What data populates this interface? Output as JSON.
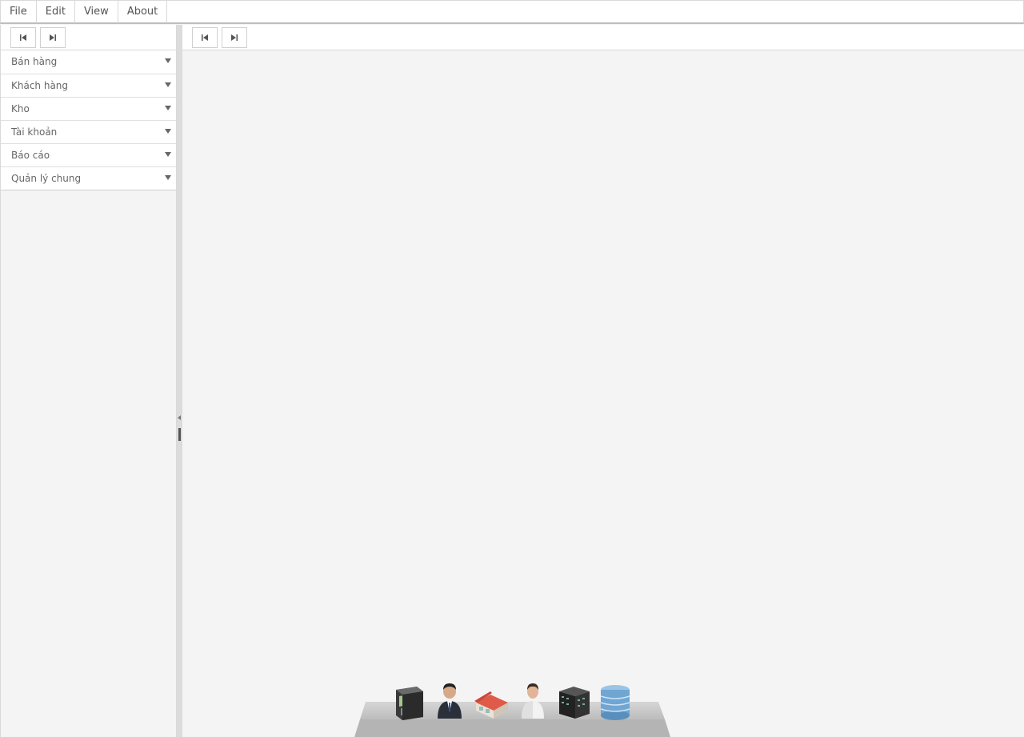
{
  "menubar": {
    "items": [
      {
        "label": "File"
      },
      {
        "label": "Edit"
      },
      {
        "label": "View"
      },
      {
        "label": "About"
      }
    ]
  },
  "sidebar": {
    "toolbar": {
      "first_icon": "first-page-icon",
      "last_icon": "last-page-icon"
    },
    "items": [
      {
        "label": "Bán hàng"
      },
      {
        "label": "Khách hàng"
      },
      {
        "label": "Kho"
      },
      {
        "label": "Tài khoản"
      },
      {
        "label": "Báo cáo"
      },
      {
        "label": "Quản lý chung"
      }
    ]
  },
  "main": {
    "toolbar": {
      "first_icon": "first-page-icon",
      "last_icon": "last-page-icon"
    }
  },
  "dock": {
    "icons": [
      "cash-register-icon",
      "businessman-icon",
      "warehouse-icon",
      "user-icon",
      "building-dark-icon",
      "building-glass-icon"
    ]
  },
  "colors": {
    "background": "#f4f4f4",
    "panel": "#ffffff",
    "border": "#d9d9d9",
    "text": "#555555"
  }
}
